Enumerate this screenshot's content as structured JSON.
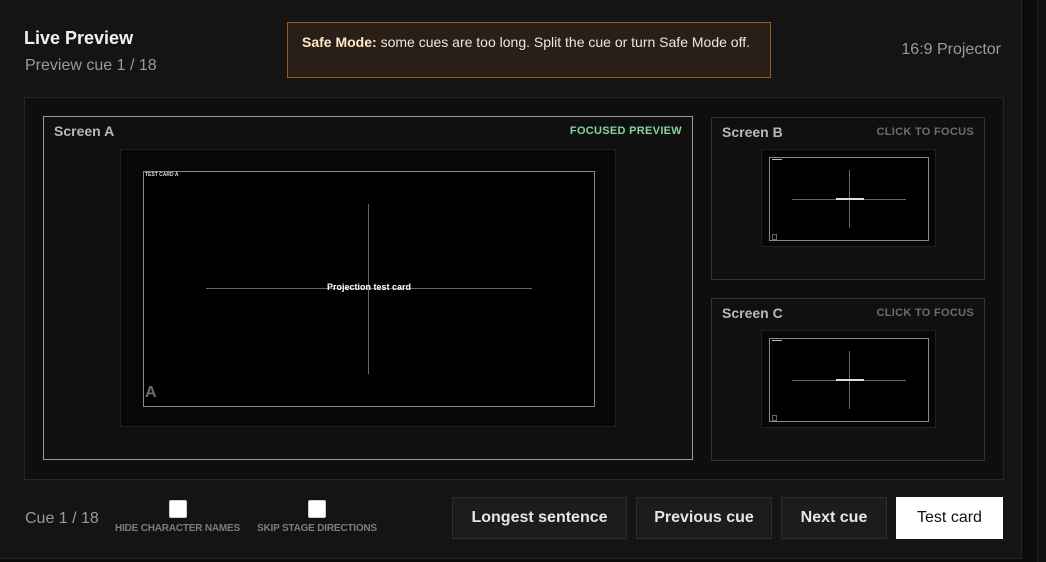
{
  "header": {
    "title": "Live Preview",
    "subtitle": "Preview cue 1 / 18",
    "safe_mode_label": "Safe Mode:",
    "safe_mode_message": "some cues are too long. Split the cue or turn Safe Mode off.",
    "aspect": "16:9 Projector"
  },
  "screens": {
    "a": {
      "label": "Screen A",
      "tag": "FOCUSED PREVIEW",
      "card_corner": "TEST CARD A",
      "card_center": "Projection test card",
      "letter": "A"
    },
    "b": {
      "label": "Screen B",
      "tag": "CLICK TO FOCUS"
    },
    "c": {
      "label": "Screen C",
      "tag": "CLICK TO FOCUS"
    }
  },
  "footer": {
    "cue_count": "Cue 1 / 18",
    "hide_character_names": "HIDE CHARACTER NAMES",
    "skip_stage_directions": "SKIP STAGE DIRECTIONS",
    "buttons": {
      "longest": "Longest sentence",
      "previous": "Previous cue",
      "next": "Next cue",
      "test_card": "Test card"
    }
  },
  "colors": {
    "accent_focus": "#8ad0a3",
    "warning_border": "#9a5a1c",
    "warning_bg": "#2a1f16"
  }
}
